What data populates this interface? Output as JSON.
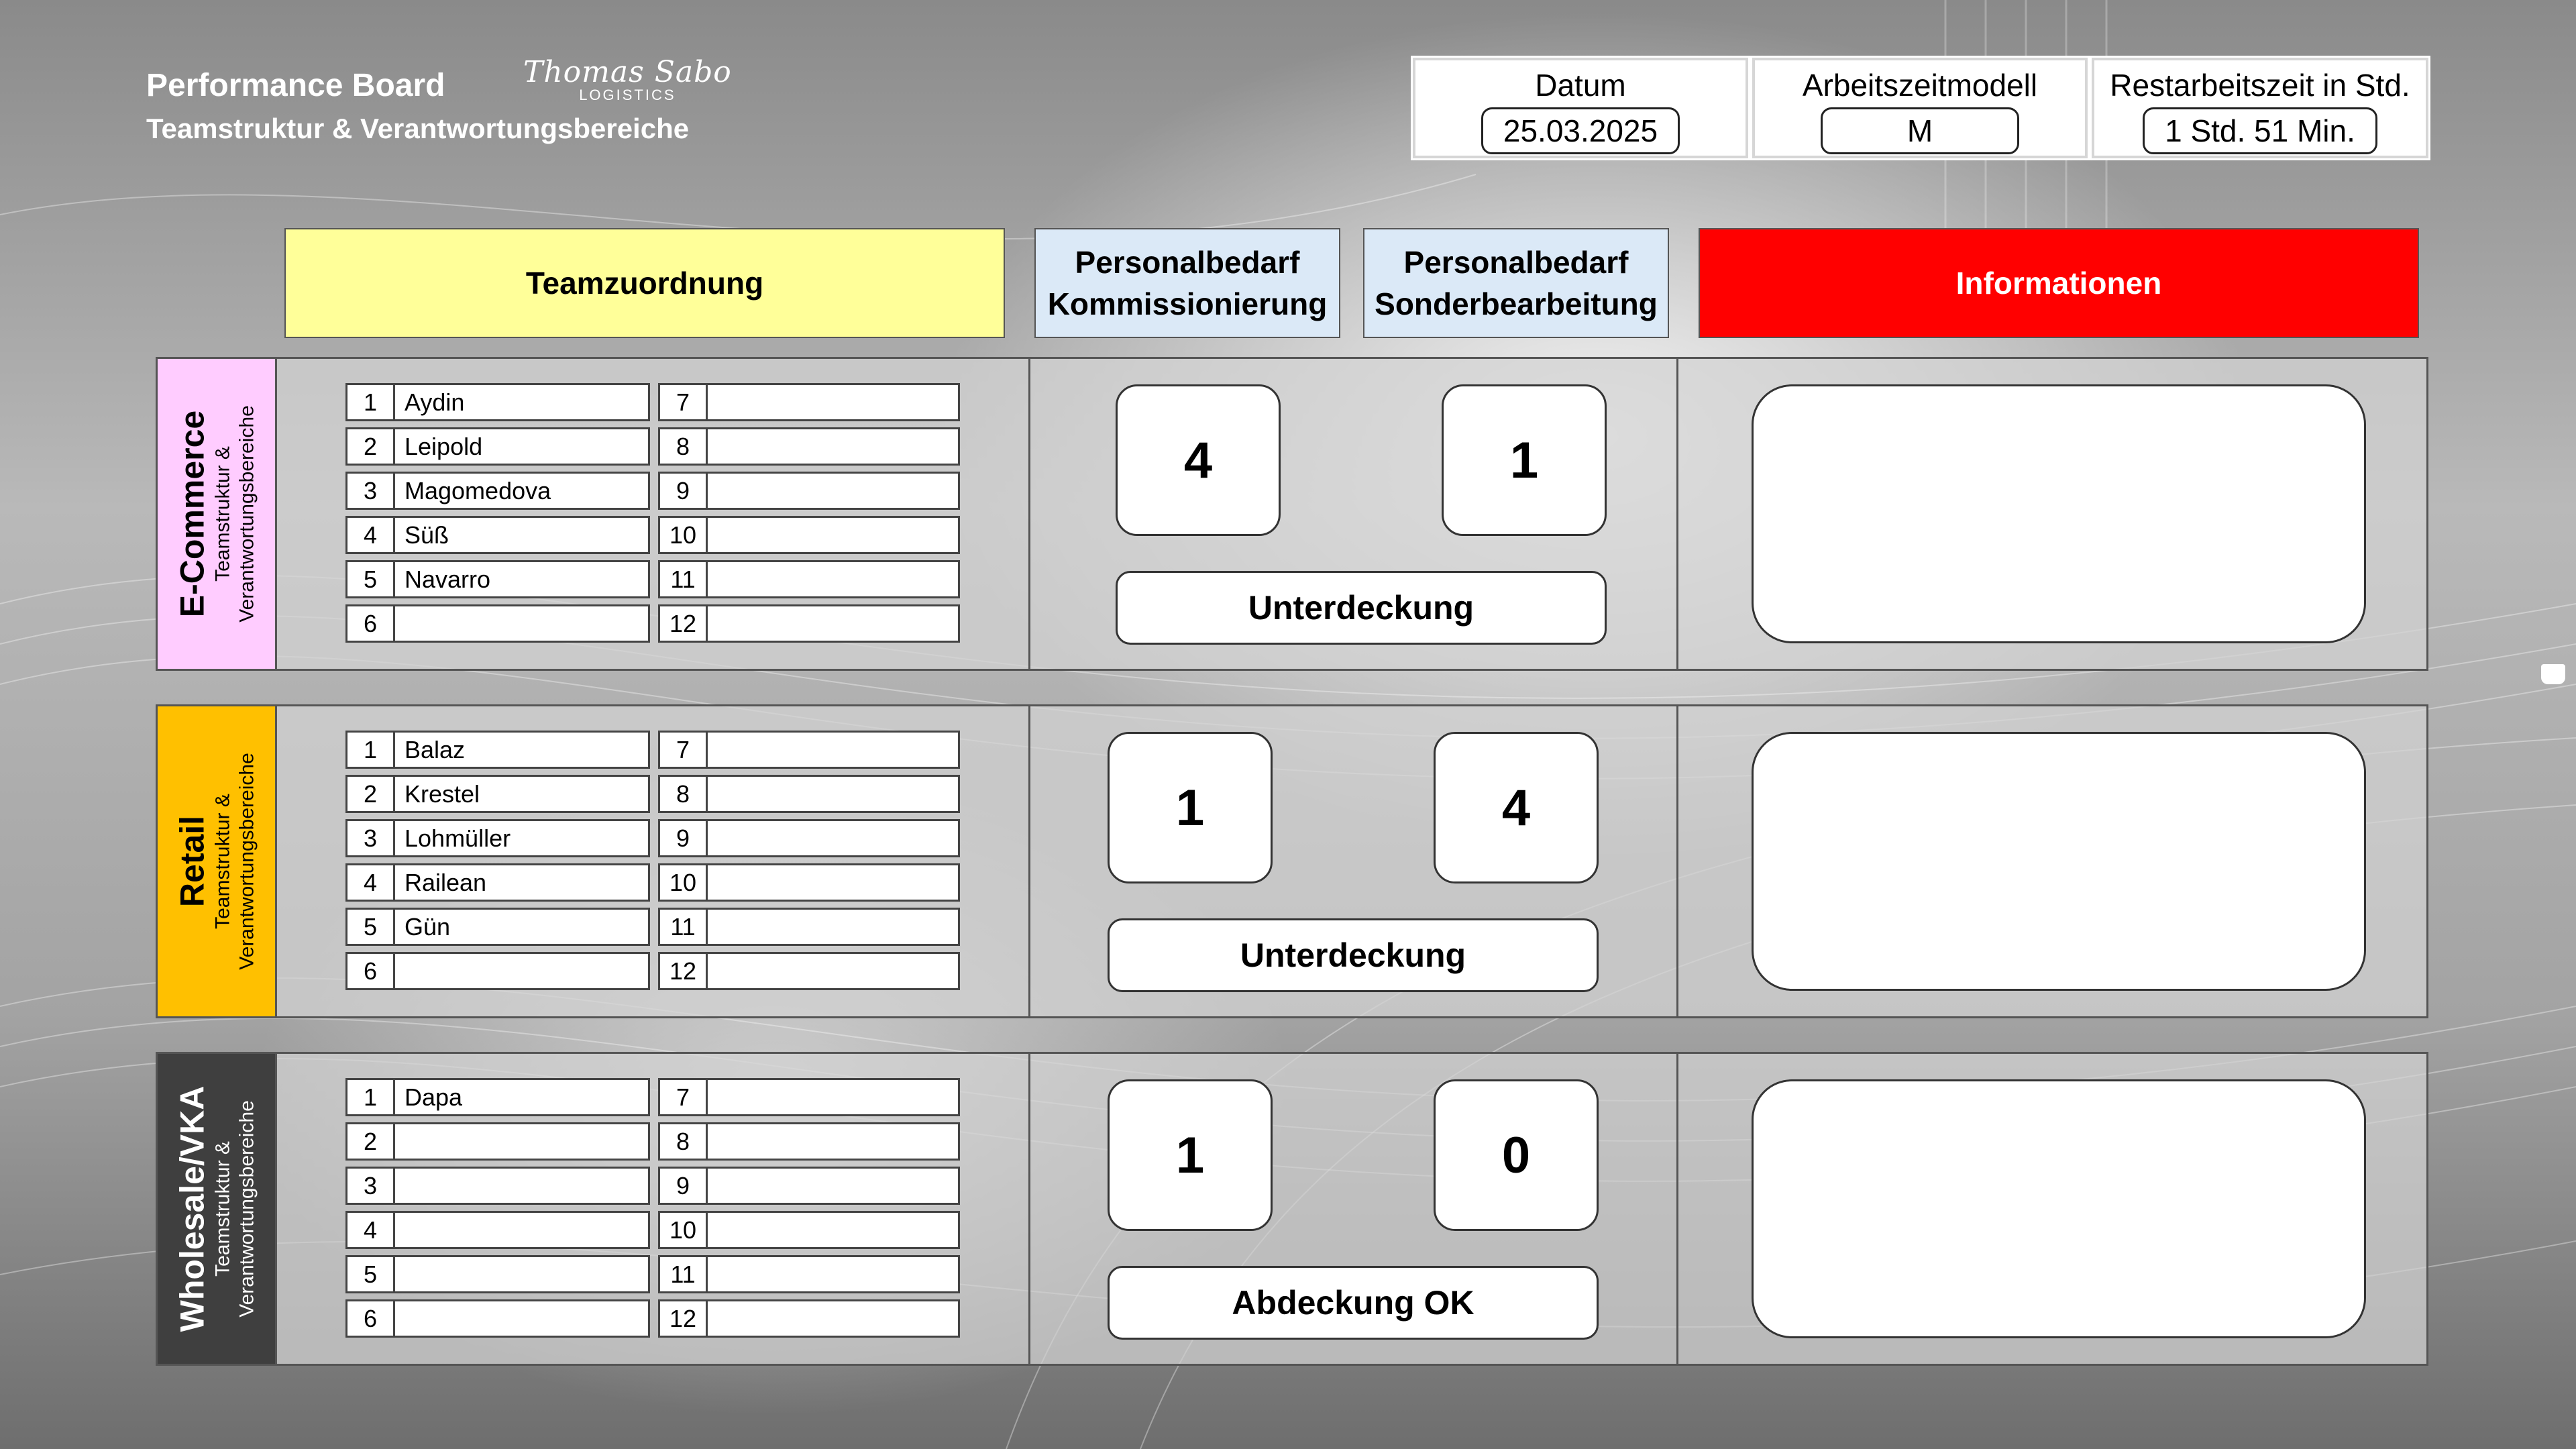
{
  "header": {
    "title": "Performance Board",
    "subtitle": "Teamstruktur & Verantwortungsbereiche",
    "logo_script": "Thomas Sabo",
    "logo_sub": "LOGISTICS"
  },
  "info": {
    "datum_label": "Datum",
    "datum_value": "25.03.2025",
    "modell_label": "Arbeitszeitmodell",
    "modell_value": "M",
    "rest_label": "Restarbeitszeit in Std.",
    "rest_value": "1 Std. 51 Min."
  },
  "columns": {
    "team": "Teamzuordnung",
    "komm_line1": "Personalbedarf",
    "komm_line2": "Kommissionierung",
    "sonder_line1": "Personalbedarf",
    "sonder_line2": "Sonderbearbeitung",
    "info": "Informationen"
  },
  "colors": {
    "team_header": "#ffff99",
    "personal_header": "#dbe9f7",
    "info_header": "#ff0000",
    "ecommerce": "#ffccff",
    "retail": "#ffc000",
    "wholesale": "#3f3f3f"
  },
  "sections": [
    {
      "title": "E-Commerce",
      "sub1": "Teamstruktur &",
      "sub2": "Verantwortungsbereiche",
      "slots_left": [
        {
          "num": "1",
          "name": "Aydin"
        },
        {
          "num": "2",
          "name": "Leipold"
        },
        {
          "num": "3",
          "name": "Magomedova"
        },
        {
          "num": "4",
          "name": "Süß"
        },
        {
          "num": "5",
          "name": "Navarro"
        },
        {
          "num": "6",
          "name": ""
        }
      ],
      "slots_right": [
        {
          "num": "7",
          "name": ""
        },
        {
          "num": "8",
          "name": ""
        },
        {
          "num": "9",
          "name": ""
        },
        {
          "num": "10",
          "name": ""
        },
        {
          "num": "11",
          "name": ""
        },
        {
          "num": "12",
          "name": ""
        }
      ],
      "kommissionierung": "4",
      "sonderbearbeitung": "1",
      "status": "Unterdeckung",
      "info_text": ""
    },
    {
      "title": "Retail",
      "sub1": "Teamstruktur &",
      "sub2": "Verantwortungsbereiche",
      "slots_left": [
        {
          "num": "1",
          "name": "Balaz"
        },
        {
          "num": "2",
          "name": "Krestel"
        },
        {
          "num": "3",
          "name": "Lohmüller"
        },
        {
          "num": "4",
          "name": "Railean"
        },
        {
          "num": "5",
          "name": "Gün"
        },
        {
          "num": "6",
          "name": ""
        }
      ],
      "slots_right": [
        {
          "num": "7",
          "name": ""
        },
        {
          "num": "8",
          "name": ""
        },
        {
          "num": "9",
          "name": ""
        },
        {
          "num": "10",
          "name": ""
        },
        {
          "num": "11",
          "name": ""
        },
        {
          "num": "12",
          "name": ""
        }
      ],
      "kommissionierung": "1",
      "sonderbearbeitung": "4",
      "status": "Unterdeckung",
      "info_text": ""
    },
    {
      "title": "Wholesale/VKA",
      "sub1": "Teamstruktur &",
      "sub2": "Verantwortungsbereiche",
      "slots_left": [
        {
          "num": "1",
          "name": "Dapa"
        },
        {
          "num": "2",
          "name": ""
        },
        {
          "num": "3",
          "name": ""
        },
        {
          "num": "4",
          "name": ""
        },
        {
          "num": "5",
          "name": ""
        },
        {
          "num": "6",
          "name": ""
        }
      ],
      "slots_right": [
        {
          "num": "7",
          "name": ""
        },
        {
          "num": "8",
          "name": ""
        },
        {
          "num": "9",
          "name": ""
        },
        {
          "num": "10",
          "name": ""
        },
        {
          "num": "11",
          "name": ""
        },
        {
          "num": "12",
          "name": ""
        }
      ],
      "kommissionierung": "1",
      "sonderbearbeitung": "0",
      "status": "Abdeckung OK",
      "info_text": ""
    }
  ]
}
